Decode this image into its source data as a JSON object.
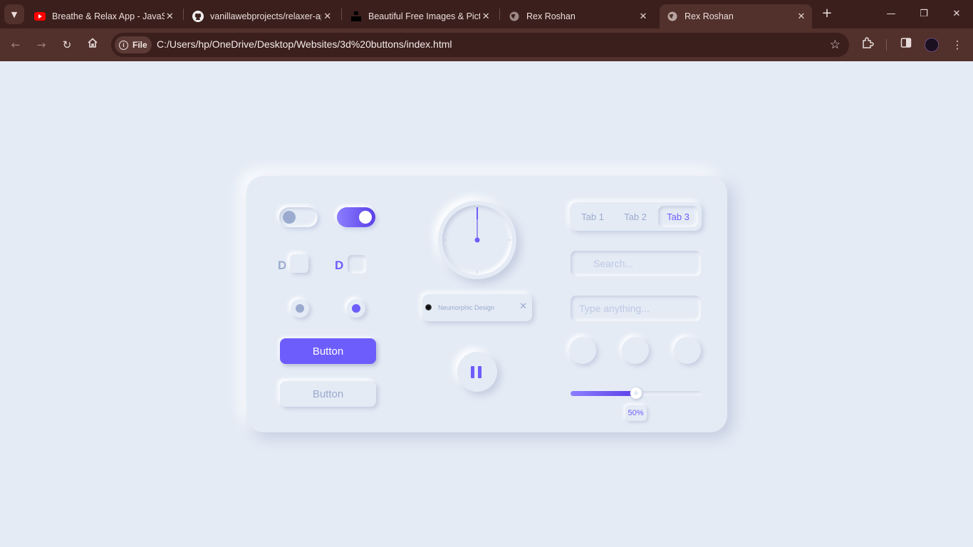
{
  "browser": {
    "tabs": [
      {
        "title": "Breathe & Relax App - JavaScript",
        "favicon": "youtube-icon",
        "active": false
      },
      {
        "title": "vanillawebprojects/relaxer-app",
        "favicon": "github-icon",
        "active": false
      },
      {
        "title": "Beautiful Free Images & Pictures",
        "favicon": "unsplash-icon",
        "active": false
      },
      {
        "title": "Rex Roshan",
        "favicon": "globe-icon",
        "active": false
      },
      {
        "title": "Rex Roshan",
        "favicon": "globe-icon",
        "active": true
      }
    ],
    "site_info_label": "File",
    "url": "C:/Users/hp/OneDrive/Desktop/Websites/3d%20buttons/index.html"
  },
  "ui_kit": {
    "accent_color": "#6d5dfc",
    "background_color": "#e4ebf5",
    "muted_color": "#9baacf",
    "toggle_left_on": false,
    "toggle_right_on": true,
    "checkbox_letter_left": "D",
    "checkbox_letter_right": "D",
    "radio_left_selected": false,
    "radio_right_selected": true,
    "primary_button_label": "Button",
    "secondary_button_label": "Button",
    "chip_label": "Neumorphic Design",
    "chip_close": "✕",
    "media_state": "playing",
    "tabs": [
      "Tab 1",
      "Tab 2",
      "Tab 3"
    ],
    "active_tab": "Tab 3",
    "search_placeholder": "Search...",
    "text_placeholder": "Type anything...",
    "slider_value_percent": 50,
    "slider_value_label": "50%"
  }
}
